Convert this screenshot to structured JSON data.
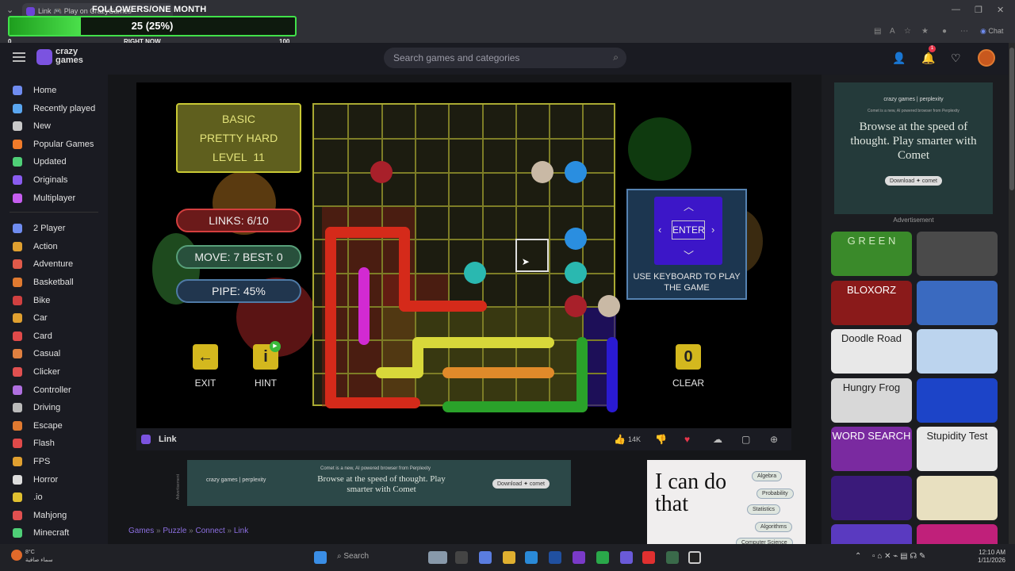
{
  "browser": {
    "tab_title": "Link 🎮 Play on CrazyGames",
    "chat_label": "Chat"
  },
  "overlay": {
    "title": "FOLLOWERS/ONE MONTH",
    "value_text": "25 (25%)",
    "progress_fraction": 0.25,
    "min": "0",
    "mid": "RIGHT NOW",
    "max": "100"
  },
  "header": {
    "logo_line1": "crazy",
    "logo_line2": "games",
    "search_placeholder": "Search games and categories",
    "notif_count": "1"
  },
  "sidebar": {
    "items": [
      {
        "label": "Home",
        "icon": "home-icon",
        "color": "#6f8cf0"
      },
      {
        "label": "Recently played",
        "icon": "clock-icon",
        "color": "#5aa6f0"
      },
      {
        "label": "New",
        "icon": "sparkle-icon",
        "color": "#c9c9c9"
      },
      {
        "label": "Popular Games",
        "icon": "fire-icon",
        "color": "#f07b2a"
      },
      {
        "label": "Updated",
        "icon": "refresh-icon",
        "color": "#4fcf77"
      },
      {
        "label": "Originals",
        "icon": "crazygames-icon",
        "color": "#8a5cf0"
      },
      {
        "label": "Multiplayer",
        "icon": "people-icon",
        "color": "#c65ef0"
      }
    ],
    "categories": [
      {
        "label": "2 Player",
        "icon": "two-player-icon",
        "color": "#6f8cf0"
      },
      {
        "label": "Action",
        "icon": "sword-icon",
        "color": "#e0a030"
      },
      {
        "label": "Adventure",
        "icon": "compass-icon",
        "color": "#e05a4a"
      },
      {
        "label": "Basketball",
        "icon": "basketball-icon",
        "color": "#e07a30"
      },
      {
        "label": "Bike",
        "icon": "bike-icon",
        "color": "#d04040"
      },
      {
        "label": "Car",
        "icon": "car-icon",
        "color": "#e0a030"
      },
      {
        "label": "Card",
        "icon": "card-icon",
        "color": "#e04a4a"
      },
      {
        "label": "Casual",
        "icon": "casual-icon",
        "color": "#e08040"
      },
      {
        "label": "Clicker",
        "icon": "cursor-icon",
        "color": "#e05050"
      },
      {
        "label": "Controller",
        "icon": "gamepad-icon",
        "color": "#b070e0"
      },
      {
        "label": "Driving",
        "icon": "steering-icon",
        "color": "#bbb"
      },
      {
        "label": "Escape",
        "icon": "door-icon",
        "color": "#e07a30"
      },
      {
        "label": "Flash",
        "icon": "flash-icon",
        "color": "#e04a4a"
      },
      {
        "label": "FPS",
        "icon": "gun-icon",
        "color": "#e0a030"
      },
      {
        "label": "Horror",
        "icon": "ghost-icon",
        "color": "#ddd"
      },
      {
        "label": ".io",
        "icon": "io-icon",
        "color": "#e0c030"
      },
      {
        "label": "Mahjong",
        "icon": "mahjong-icon",
        "color": "#e05050"
      },
      {
        "label": "Minecraft",
        "icon": "minecraft-icon",
        "color": "#4fcf77"
      }
    ]
  },
  "game": {
    "difficulty": "BASIC",
    "tier": "PRETTY HARD",
    "level_label": "LEVEL",
    "level": "11",
    "links": "LINKS:  6/10",
    "moves": "MOVE: 7   BEST: 0",
    "pipe": "PIPE:  45%",
    "exit_label": "EXIT",
    "hint_label": "HINT",
    "hint_count": "▶",
    "clear_label": "CLEAR",
    "clear_count": "0",
    "enter_label": "ENTER",
    "keyboard_hint": "USE KEYBOARD TO PLAY THE GAME"
  },
  "game_footer": {
    "title": "Link",
    "likes": "14K"
  },
  "ads": {
    "right_brand": "crazy games  |  perplexity",
    "right_small": "Comet is a new, AI powered browser from Perplexity",
    "right_title": "Browse at the speed of thought. Play smarter with Comet",
    "right_button": "Download ✦ comet",
    "ad_label": "Advertisement",
    "bottom_brand": "crazy games  |  perplexity",
    "bottom_small": "Comet is a new, AI powered browser from Perplexity",
    "bottom_title": "Browse at the speed of thought. Play smarter with Comet",
    "bottom_button": "Download ✦ comet",
    "bottom_side_label": "Advertisement",
    "side_title": "I can do that",
    "side_chips": [
      "Algebra",
      "Probability",
      "Statistics",
      "Algorithms",
      "Computer Science"
    ]
  },
  "thumbnails": [
    {
      "title": "G R E E N",
      "bg": "#3a8a2a",
      "fg": "#cfe8c0"
    },
    {
      "title": "",
      "bg": "#4a4a4a",
      "fg": "#fff"
    },
    {
      "title": "BLOXORZ",
      "bg": "#8a1a1a",
      "fg": "#fff"
    },
    {
      "title": "",
      "bg": "#3a6ac0",
      "fg": "#fff"
    },
    {
      "title": "Doodle Road",
      "bg": "#e8e8e8",
      "fg": "#222"
    },
    {
      "title": "",
      "bg": "#bcd4ee",
      "fg": "#fff"
    },
    {
      "title": "Hungry Frog",
      "bg": "#d8d8d8",
      "fg": "#222"
    },
    {
      "title": "",
      "bg": "#1c44c8",
      "fg": "#fff"
    },
    {
      "title": "WORD SEARCH",
      "bg": "#7a2aa0",
      "fg": "#fff"
    },
    {
      "title": "Stupidity Test",
      "bg": "#e8e8e8",
      "fg": "#222"
    },
    {
      "title": "",
      "bg": "#3a1a7a",
      "fg": "#fff"
    },
    {
      "title": "",
      "bg": "#e8e0c0",
      "fg": "#222"
    },
    {
      "title": "",
      "bg": "#5a3ac0",
      "fg": "#fff"
    },
    {
      "title": "",
      "bg": "#c0207a",
      "fg": "#fff"
    }
  ],
  "breadcrumb": {
    "games": "Games",
    "puzzle": "Puzzle",
    "connect": "Connect",
    "link": "Link"
  },
  "taskbar": {
    "temp": "8°C",
    "weather": "سماء صافية",
    "search": "Search",
    "time": "12:10 AM",
    "date": "1/11/2026"
  }
}
